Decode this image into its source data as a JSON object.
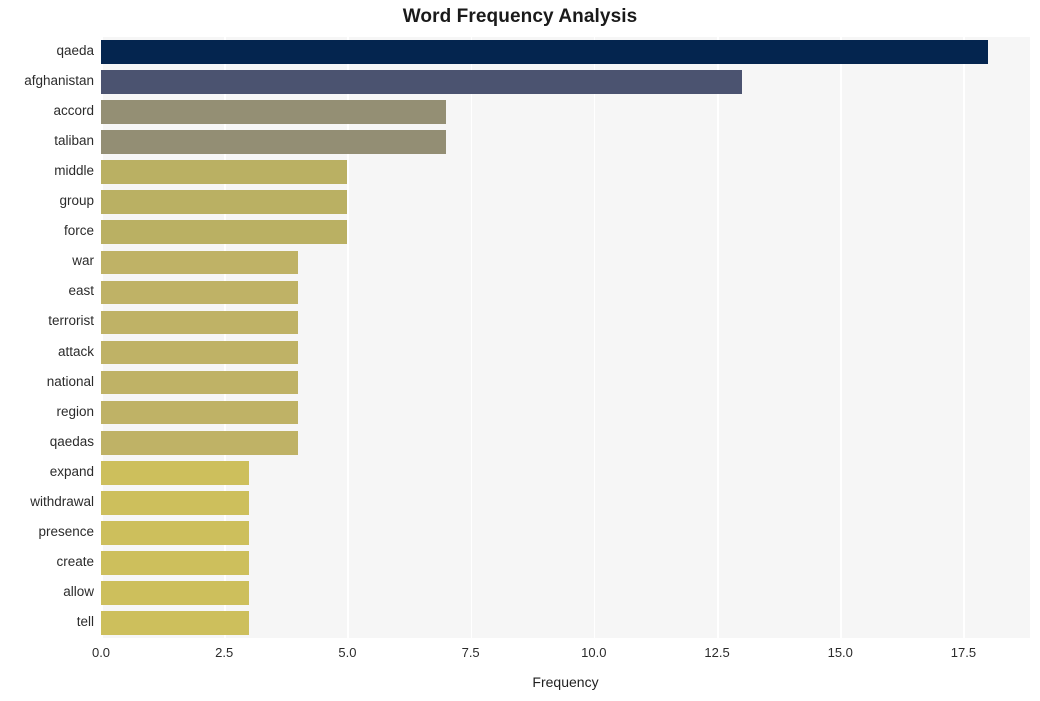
{
  "chart_data": {
    "type": "bar",
    "orientation": "horizontal",
    "title": "Word Frequency Analysis",
    "xlabel": "Frequency",
    "ylabel": "",
    "xlim": [
      0,
      18.85
    ],
    "xticks": [
      0.0,
      2.5,
      5.0,
      7.5,
      10.0,
      12.5,
      15.0,
      17.5
    ],
    "xtick_labels": [
      "0.0",
      "2.5",
      "5.0",
      "7.5",
      "10.0",
      "12.5",
      "15.0",
      "17.5"
    ],
    "grid": true,
    "grid_axis": "x",
    "grid_color": "#ffffff",
    "plot_background": "#f6f6f6",
    "figure_background": "#ffffff",
    "legend": null,
    "categories": [
      "qaeda",
      "afghanistan",
      "accord",
      "taliban",
      "middle",
      "group",
      "force",
      "war",
      "east",
      "terrorist",
      "attack",
      "national",
      "region",
      "qaedas",
      "expand",
      "withdrawal",
      "presence",
      "create",
      "allow",
      "tell"
    ],
    "values": [
      18,
      13,
      7,
      7,
      5,
      5,
      5,
      4,
      4,
      4,
      4,
      4,
      4,
      4,
      3,
      3,
      3,
      3,
      3,
      3
    ],
    "bar_colors": [
      "#04254f",
      "#4b5370",
      "#948f74",
      "#938e74",
      "#bab063",
      "#bab063",
      "#bab063",
      "#bfb266",
      "#bfb266",
      "#bfb266",
      "#bfb266",
      "#bfb266",
      "#bfb266",
      "#bfb266",
      "#cdbf5c",
      "#cdbf5c",
      "#cdbf5c",
      "#cdbf5c",
      "#cdbf5c",
      "#cdbf5c"
    ],
    "bars": [
      {
        "label": "qaeda",
        "value": 18,
        "color": "#04254f"
      },
      {
        "label": "afghanistan",
        "value": 13,
        "color": "#4b5370"
      },
      {
        "label": "accord",
        "value": 7,
        "color": "#948f74"
      },
      {
        "label": "taliban",
        "value": 7,
        "color": "#938e74"
      },
      {
        "label": "middle",
        "value": 5,
        "color": "#bab063"
      },
      {
        "label": "group",
        "value": 5,
        "color": "#bab063"
      },
      {
        "label": "force",
        "value": 5,
        "color": "#bab063"
      },
      {
        "label": "war",
        "value": 4,
        "color": "#bfb266"
      },
      {
        "label": "east",
        "value": 4,
        "color": "#bfb266"
      },
      {
        "label": "terrorist",
        "value": 4,
        "color": "#bfb266"
      },
      {
        "label": "attack",
        "value": 4,
        "color": "#bfb266"
      },
      {
        "label": "national",
        "value": 4,
        "color": "#bfb266"
      },
      {
        "label": "region",
        "value": 4,
        "color": "#bfb266"
      },
      {
        "label": "qaedas",
        "value": 4,
        "color": "#bfb266"
      },
      {
        "label": "expand",
        "value": 3,
        "color": "#cdbf5c"
      },
      {
        "label": "withdrawal",
        "value": 3,
        "color": "#cdbf5c"
      },
      {
        "label": "presence",
        "value": 3,
        "color": "#cdbf5c"
      },
      {
        "label": "create",
        "value": 3,
        "color": "#cdbf5c"
      },
      {
        "label": "allow",
        "value": 3,
        "color": "#cdbf5c"
      },
      {
        "label": "tell",
        "value": 3,
        "color": "#cdbf5c"
      }
    ]
  }
}
